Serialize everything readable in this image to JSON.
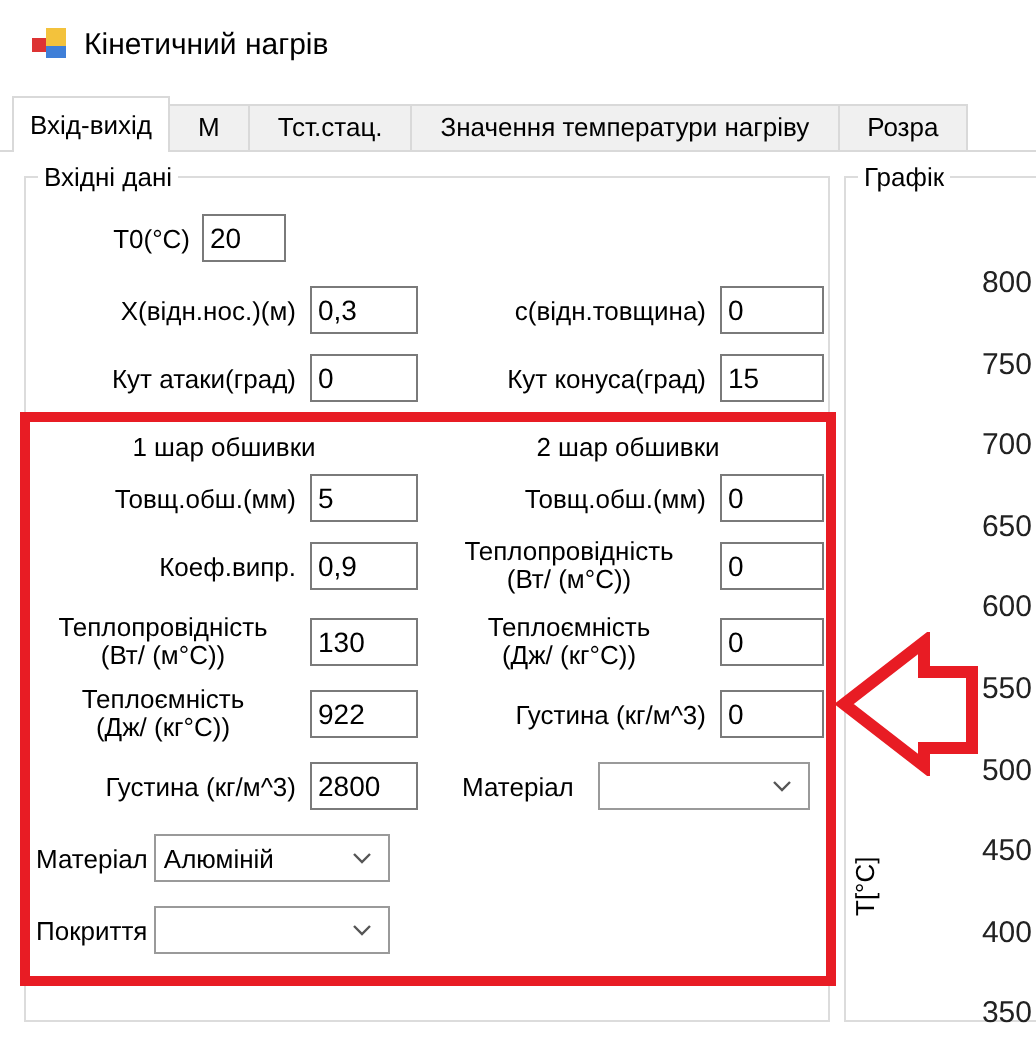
{
  "window": {
    "title": "Кінетичний нагрів"
  },
  "tabs": [
    {
      "label": "Вхід-вихід",
      "selected": true
    },
    {
      "label": "М",
      "selected": false
    },
    {
      "label": "Тст.стац.",
      "selected": false
    },
    {
      "label": "Значення температури нагріву",
      "selected": false
    },
    {
      "label": "Розра",
      "selected": false
    }
  ],
  "input_group": {
    "title": "Вхідні дані",
    "initial": {
      "label": "T0(°C)",
      "value": "20"
    },
    "rows": [
      [
        {
          "label": "X(відн.нос.)(м)",
          "value": "0,3"
        },
        {
          "label": "с(відн.товщина)",
          "value": "0"
        }
      ],
      [
        {
          "label": "Кут атаки(град)",
          "value": "0"
        },
        {
          "label": "Кут конуса(град)",
          "value": "15"
        }
      ]
    ],
    "layers": [
      {
        "title": "1 шар обшивки",
        "fields": [
          {
            "label": "Товщ.обш.(мм)",
            "value": "5"
          },
          {
            "label": "Коеф.випр.",
            "value": "0,9"
          },
          {
            "label": "Теплопровідність\n(Вт/ (м°С))",
            "value": "130"
          },
          {
            "label": "Теплоємність\n(Дж/ (кг°С))",
            "value": "922"
          },
          {
            "label": "Густина (кг/м^3)",
            "value": "2800"
          }
        ],
        "selects": [
          {
            "label": "Матеріал",
            "value": "Алюміній"
          },
          {
            "label": "Покриття"
          }
        ]
      },
      {
        "title": "2 шар обшивки",
        "fields": [
          {
            "label": "Товщ.обш.(мм)",
            "value": "0"
          },
          {
            "label": "Теплопровідність\n(Вт/ (м°С))",
            "value": "0"
          },
          {
            "label": "Теплоємність\n(Дж/ (кг°С))",
            "value": "0"
          },
          {
            "label": "Густина (кг/м^3)",
            "value": "0"
          }
        ],
        "selects": [
          {
            "label": "Матеріал"
          }
        ]
      }
    ]
  },
  "graph_group": {
    "title": "Графік",
    "axis_title": "T[°C]",
    "y_ticks": [
      "800",
      "750",
      "700",
      "650",
      "600",
      "550",
      "500",
      "450",
      "400",
      "350"
    ]
  }
}
